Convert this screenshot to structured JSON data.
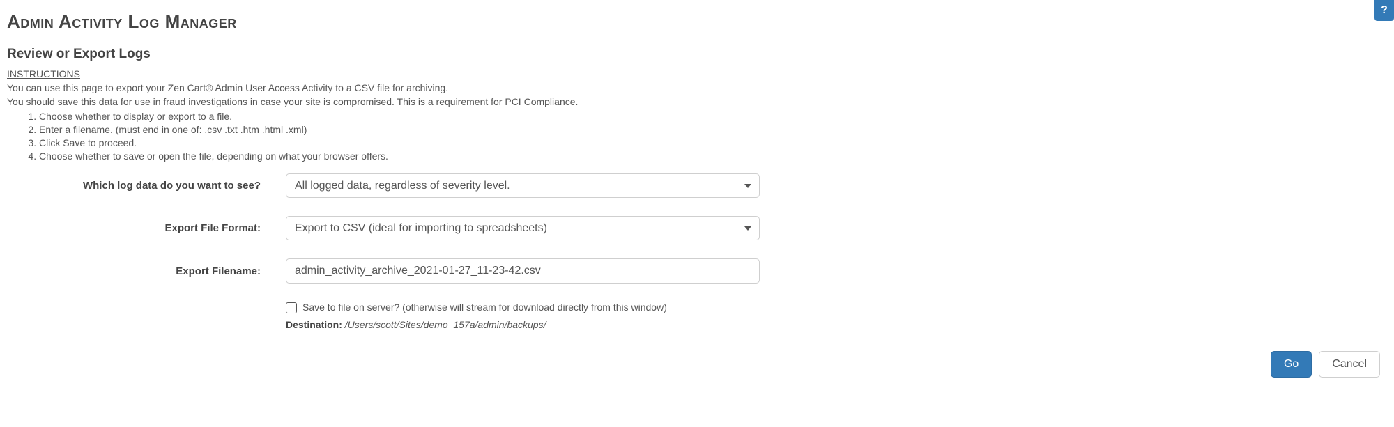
{
  "help_icon": "?",
  "page_title": "Admin Activity Log Manager",
  "section_title": "Review or Export Logs",
  "instructions_header": "INSTRUCTIONS",
  "instructions_line1": "You can use this page to export your Zen Cart® Admin User Access Activity to a CSV file for archiving.",
  "instructions_line2": "You should save this data for use in fraud investigations in case your site is compromised. This is a requirement for PCI Compliance.",
  "steps": {
    "0": "Choose whether to display or export to a file.",
    "1": "Enter a filename. (must end in one of: .csv .txt .htm .html .xml)",
    "2": "Click Save to proceed.",
    "3": "Choose whether to save or open the file, depending on what your browser offers."
  },
  "form": {
    "log_data_label": "Which log data do you want to see?",
    "log_data_value": "All logged data, regardless of severity level.",
    "format_label": "Export File Format:",
    "format_value": "Export to CSV (ideal for importing to spreadsheets)",
    "filename_label": "Export Filename:",
    "filename_value": "admin_activity_archive_2021-01-27_11-23-42.csv",
    "save_server_label": "Save to file on server? (otherwise will stream for download directly from this window)",
    "destination_label": "Destination: ",
    "destination_path": "/Users/scott/Sites/demo_157a/admin/backups/"
  },
  "buttons": {
    "go": "Go",
    "cancel": "Cancel"
  }
}
